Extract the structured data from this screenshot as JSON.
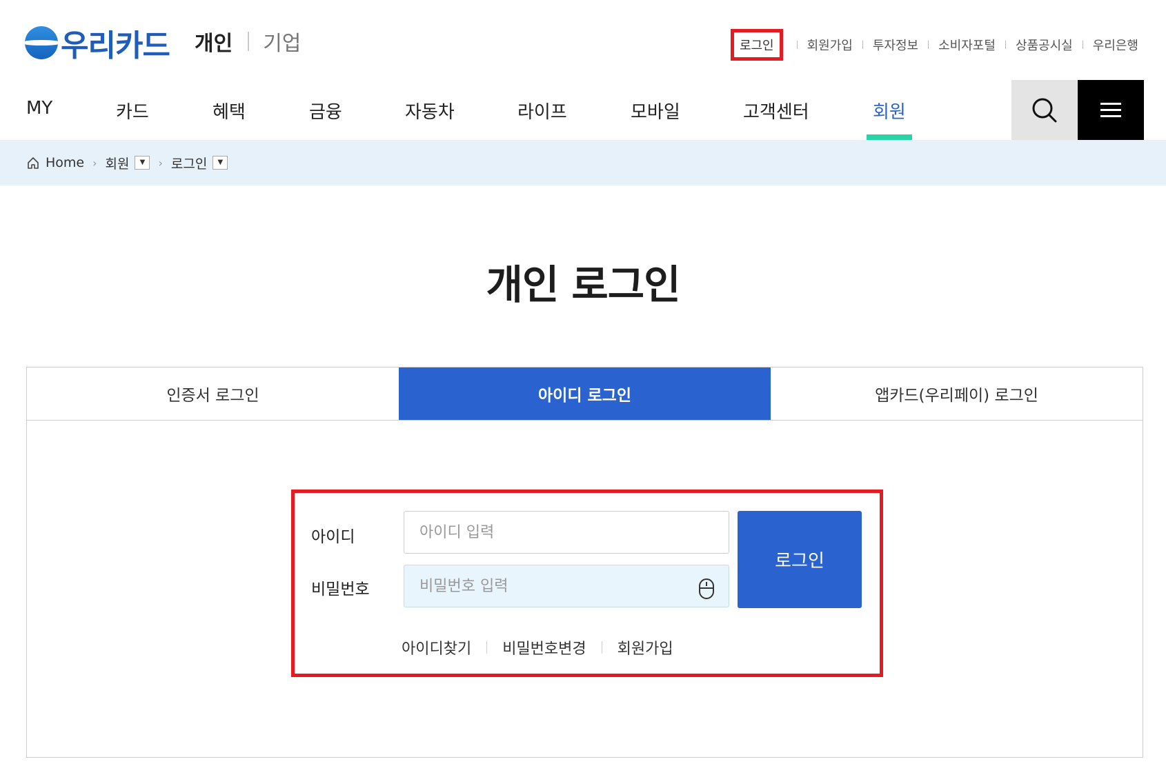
{
  "brand": {
    "logo_text": "우리카드",
    "segment_personal": "개인",
    "segment_corporate": "기업"
  },
  "top_menu": {
    "login": "로그인",
    "signup": "회원가입",
    "investor": "투자정보",
    "consumer": "소비자포털",
    "product": "상품공시실",
    "bank": "우리은행"
  },
  "gnb": {
    "items": [
      "MY",
      "카드",
      "혜택",
      "금융",
      "자동차",
      "라이프",
      "모바일",
      "고객센터",
      "회원"
    ],
    "active_index": 8
  },
  "breadcrumb": {
    "home": "Home",
    "level1": "회원",
    "level2": "로그인"
  },
  "page_title": "개인 로그인",
  "tabs": [
    "인증서 로그인",
    "아이디 로그인",
    "앱카드(우리페이) 로그인"
  ],
  "form": {
    "id_label": "아이디",
    "id_placeholder": "아이디 입력",
    "pw_label": "비밀번호",
    "pw_placeholder": "비밀번호 입력",
    "submit": "로그인"
  },
  "links": {
    "find_id": "아이디찾기",
    "change_pw": "비밀번호변경",
    "signup": "회원가입"
  },
  "colors": {
    "brand_blue": "#2a63cf",
    "highlight_red": "#e31c23",
    "active_green": "#28d3a8",
    "crumb_bg": "#e6f1f9"
  }
}
